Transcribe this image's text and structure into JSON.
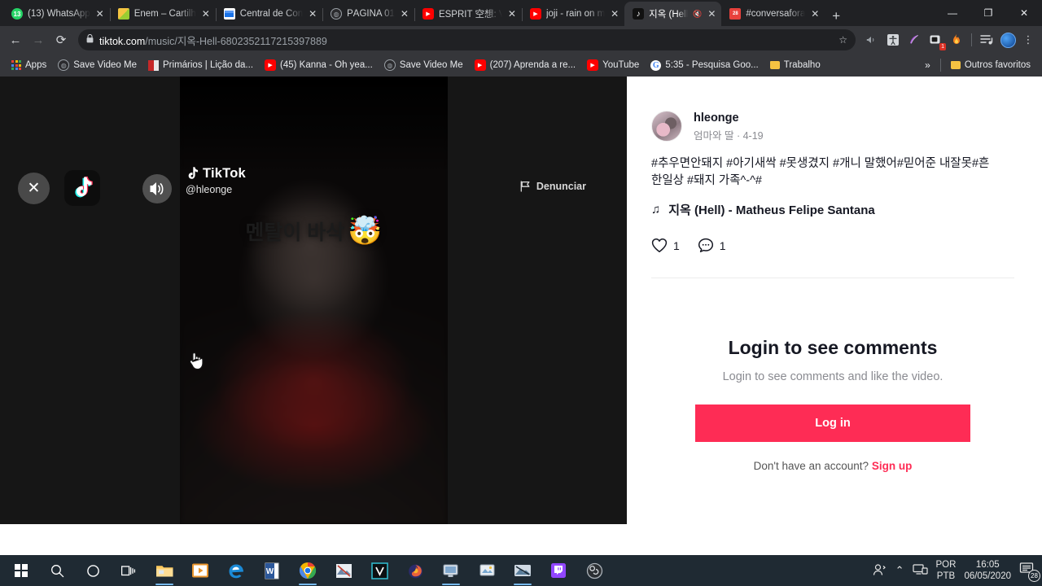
{
  "browser": {
    "tabs": [
      {
        "title": "(13) WhatsApp",
        "icon": "whatsapp-icon",
        "active": false,
        "muted": false
      },
      {
        "title": "Enem – Cartilh",
        "icon": "enem-icon",
        "active": false,
        "muted": false
      },
      {
        "title": "Central de Con",
        "icon": "central-icon",
        "active": false,
        "muted": false
      },
      {
        "title": "PÁGINA 01",
        "icon": "globe-icon",
        "active": false,
        "muted": false
      },
      {
        "title": "ESPRIT 空想: V",
        "icon": "youtube-icon",
        "active": false,
        "muted": false
      },
      {
        "title": "joji - rain on m",
        "icon": "youtube-icon",
        "active": false,
        "muted": false
      },
      {
        "title": "지옥 (Hell",
        "icon": "tiktok-icon",
        "active": true,
        "muted": true
      },
      {
        "title": "#conversafora",
        "icon": "calendar-icon",
        "active": false,
        "muted": false
      }
    ],
    "new_tab_label": "+",
    "window_controls": {
      "minimize": "—",
      "maximize": "❐",
      "close": "✕"
    },
    "nav": {
      "back": "←",
      "forward": "→",
      "reload": "⟳"
    },
    "omnibox": {
      "lock": "🔒",
      "url_host": "tiktok.com",
      "url_path": "/music/지옥-Hell-6802352117215397889",
      "star": "☆"
    },
    "extensions": [
      {
        "name": "media-control-icon",
        "glyph": "◀"
      },
      {
        "name": "accessibility-extension-icon",
        "glyph": "⚘"
      },
      {
        "name": "feather-extension-icon",
        "glyph": "✎"
      },
      {
        "name": "video-download-extension-icon",
        "glyph": "▣",
        "badge": "1"
      },
      {
        "name": "flame-extension-icon",
        "glyph": "🔥"
      },
      {
        "name": "playlist-extension-icon",
        "glyph": "☰"
      }
    ],
    "kebab": "⋮",
    "bookmarks": [
      {
        "label": "Apps",
        "icon": "apps-grid-icon"
      },
      {
        "label": "Save Video Me",
        "icon": "globe-icon"
      },
      {
        "label": "Primários | Lição da...",
        "icon": "primarios-icon"
      },
      {
        "label": "(45) Kanna - Oh yea...",
        "icon": "youtube-icon"
      },
      {
        "label": "Save Video Me",
        "icon": "globe-icon"
      },
      {
        "label": "(207) Aprenda a re...",
        "icon": "youtube-icon"
      },
      {
        "label": "YouTube",
        "icon": "youtube-icon"
      },
      {
        "label": "5:35 - Pesquisa Goo...",
        "icon": "google-icon"
      },
      {
        "label": "Trabalho",
        "icon": "folder-icon"
      }
    ],
    "bookmarks_overflow": "»",
    "other_bookmarks": {
      "label": "Outros favoritos",
      "icon": "folder-icon"
    }
  },
  "player": {
    "close_label": "✕",
    "app_logo": "♪",
    "volume_label": "volume-on",
    "brand_name": "TikTok",
    "brand_username": "@hleonge",
    "report_label": "Denunciar",
    "video_caption": "멘탈이 바삭",
    "video_caption_emoji": "🤯"
  },
  "post": {
    "author": "hleonge",
    "author_sub": "엄마와 딸 · 4-19",
    "caption": "#추우면안돼지 #아기새싹 #못생겼지 #개니 말했어#믿어준 내잘못#흔한일상 #돼지 가족^-^#",
    "music_note": "♫",
    "music_title": "지옥 (Hell) - Matheus Felipe Santana",
    "likes": "1",
    "comments": "1"
  },
  "login": {
    "title": "Login to see comments",
    "subtitle": "Login to see comments and like the video.",
    "button_label": "Log in",
    "no_account_text": "Don't have an account?",
    "signup_label": "Sign up",
    "accent_color": "#fe2c55"
  },
  "taskbar": {
    "items": [
      {
        "name": "start-button",
        "icon": "windows-logo-icon"
      },
      {
        "name": "search-button",
        "icon": "search-icon"
      },
      {
        "name": "cortana-button",
        "icon": "cortana-circle-icon"
      },
      {
        "name": "task-view-button",
        "icon": "task-view-icon"
      },
      {
        "name": "file-explorer-button",
        "icon": "folder-icon",
        "running": true
      },
      {
        "name": "media-player-button",
        "icon": "media-player-icon"
      },
      {
        "name": "edge-button",
        "icon": "edge-icon"
      },
      {
        "name": "word-button",
        "icon": "word-icon"
      },
      {
        "name": "chrome-button",
        "icon": "chrome-icon",
        "running": true
      },
      {
        "name": "editor-button",
        "icon": "editor-icon"
      },
      {
        "name": "vegas-button",
        "icon": "vegas-icon"
      },
      {
        "name": "firefox-button",
        "icon": "firefox-icon"
      },
      {
        "name": "monitor-app-button",
        "icon": "monitor-icon",
        "running": true
      },
      {
        "name": "paint-button",
        "icon": "paint-icon"
      },
      {
        "name": "photoshop-button",
        "icon": "photo-editor-icon",
        "running": true
      },
      {
        "name": "twitch-button",
        "icon": "twitch-icon"
      },
      {
        "name": "obs-button",
        "icon": "obs-icon"
      }
    ],
    "tray": {
      "people_icon": "people-icon",
      "chevron": "⌃",
      "network_icon": "network-icon",
      "lang_top": "POR",
      "lang_bottom": "PTB",
      "time": "16:05",
      "date": "06/05/2020",
      "notification_count": "28"
    }
  }
}
